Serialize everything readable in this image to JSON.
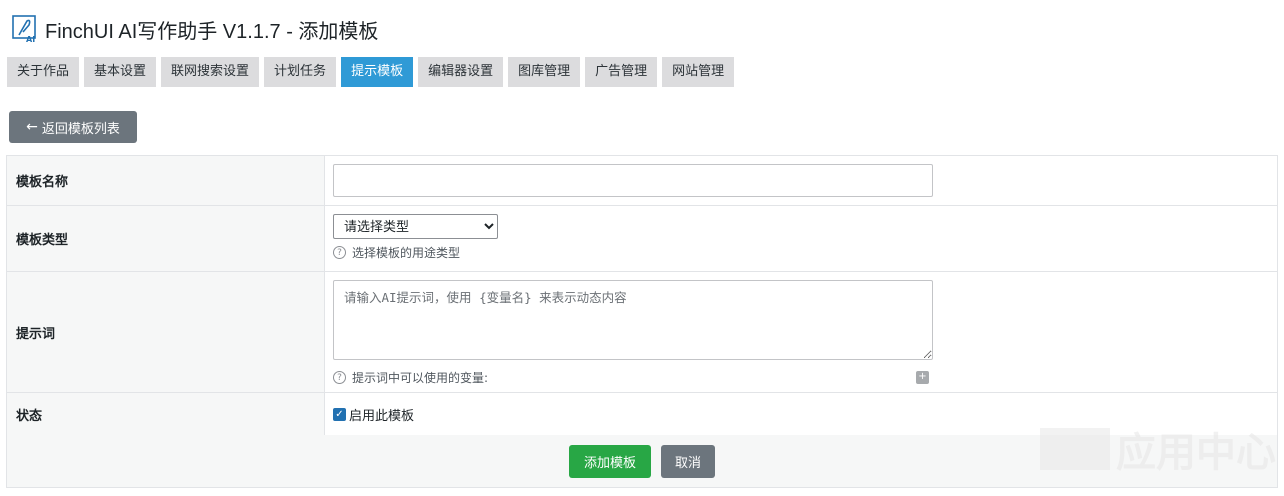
{
  "header": {
    "title": "FinchUI AI写作助手 V1.1.7 - 添加模板"
  },
  "tabs": [
    {
      "label": "关于作品"
    },
    {
      "label": "基本设置"
    },
    {
      "label": "联网搜索设置"
    },
    {
      "label": "计划任务"
    },
    {
      "label": "提示模板"
    },
    {
      "label": "编辑器设置"
    },
    {
      "label": "图库管理"
    },
    {
      "label": "广告管理"
    },
    {
      "label": "网站管理"
    }
  ],
  "active_tab": "提示模板",
  "back_button": {
    "label": "返回模板列表"
  },
  "form": {
    "name": {
      "label": "模板名称",
      "value": ""
    },
    "type": {
      "label": "模板类型",
      "selected": "请选择类型",
      "hint": "选择模板的用途类型"
    },
    "prompt": {
      "label": "提示词",
      "placeholder": "请输入AI提示词，使用 {变量名} 来表示动态内容",
      "hint": "提示词中可以使用的变量:"
    },
    "status": {
      "label": "状态",
      "checkbox_label": "启用此模板",
      "checked": true
    }
  },
  "actions": {
    "submit_label": "添加模板",
    "cancel_label": "取消"
  },
  "watermark": {
    "text": "应用中心"
  },
  "colors": {
    "accent": "#2f9ad6",
    "primary": "#28a745",
    "secondary": "#6c757d"
  }
}
